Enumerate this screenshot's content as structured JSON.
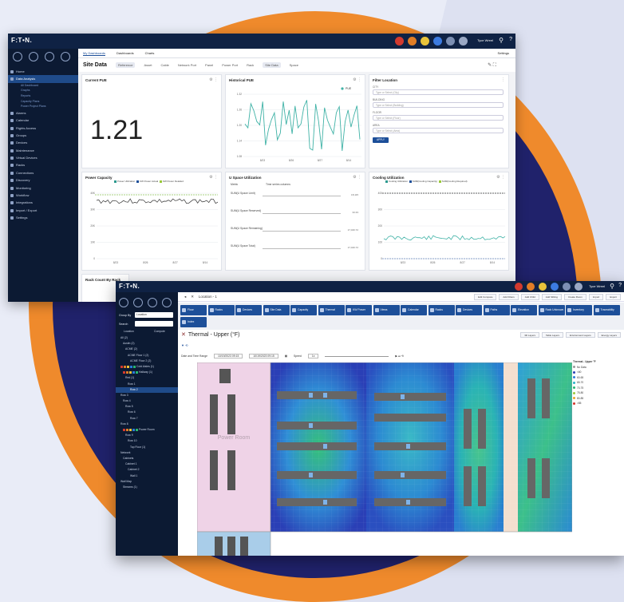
{
  "colors": {
    "ring": "#ef8a2c",
    "ring_inner": "#20226b",
    "topbar": "#0f2244",
    "sidebar": "#0c1a33",
    "accent": "#1d4f99"
  },
  "app1": {
    "logo": "F:T•N.",
    "user_label": "Tyce Wreel",
    "tabs": [
      "My Dashboards",
      "Dashboards",
      "Charts"
    ],
    "settings_label": "Settings",
    "breadcrumb_title": "Site Data",
    "filters": [
      "Reference",
      "Asset",
      "Cable",
      "Network Port",
      "Panel",
      "Power Port",
      "Rack",
      "Site Data",
      "Space"
    ],
    "nav": [
      {
        "label": "Home"
      },
      {
        "label": "Data Analysis",
        "active": true
      },
      {
        "label": "All Dashboard",
        "sub": true
      },
      {
        "label": "Graphs",
        "sub": true
      },
      {
        "label": "Reports",
        "sub": true
      },
      {
        "label": "Capacity Plans",
        "sub": true
      },
      {
        "label": "Power Project Plans",
        "sub": true
      },
      {
        "label": "Alarms"
      },
      {
        "label": "Calendar"
      },
      {
        "label": "Rights Access"
      },
      {
        "label": "Groups"
      },
      {
        "label": "Devices"
      },
      {
        "label": "Maintenance"
      },
      {
        "label": "Virtual Devices"
      },
      {
        "label": "Racks"
      },
      {
        "label": "Connections"
      },
      {
        "label": "Discovery"
      },
      {
        "label": "Monitoring"
      },
      {
        "label": "Workflow"
      },
      {
        "label": "Integrations"
      },
      {
        "label": "Import / Export"
      },
      {
        "label": "Settings"
      }
    ],
    "current_pue": {
      "title": "Current PUE",
      "value": "1.21"
    },
    "historical_pue": {
      "title": "Historical PUE",
      "legend": "PUE",
      "yticks": [
        "1.32",
        "1.26",
        "1.20",
        "1.14",
        "1.08"
      ],
      "xticks": [
        "8/23",
        "8/26",
        "8/27",
        "8/14"
      ]
    },
    "filter_location": {
      "title": "Filter Location",
      "fields": [
        {
          "label": "CITY",
          "placeholder": "Type or Select (City)"
        },
        {
          "label": "BUILDING",
          "placeholder": "Type or Select (Building)"
        },
        {
          "label": "FLOOR",
          "placeholder": "Type or Select (Floor)"
        },
        {
          "label": "AREA",
          "placeholder": "Type or Select (Area)"
        }
      ],
      "apply": "APPLY"
    },
    "power_capacity": {
      "title": "Power Capacity",
      "legend": [
        "Power Utilization",
        "KW Power Actual",
        "KW Power Detailed"
      ],
      "yticks": [
        "40K",
        "30K",
        "20K",
        "10K",
        "0"
      ],
      "xticks": [
        "8/23",
        "8/26",
        "8/27",
        "8/14"
      ]
    },
    "u_space": {
      "title": "U Space Utilization",
      "col1": "Metric",
      "col2": "Time series columns",
      "rows": [
        {
          "label": "SUM(U Space Limit)",
          "values": [
            "18,115",
            "17,230"
          ]
        },
        {
          "label": "SUM(U Space Reserved)",
          "values": [
            "33.33"
          ]
        },
        {
          "label": "SUM(U Space Remaining)",
          "values": [
            "17,040.72",
            "17,022.32"
          ]
        },
        {
          "label": "SUM(U Space Total)",
          "values": [
            "17,040.72",
            "18,094.40"
          ]
        }
      ]
    },
    "cooling": {
      "title": "Cooling Utilization",
      "legend": [
        "Cooling Utilization",
        "SUM(Cooling Capacity)",
        "SUM(Cooling Required)"
      ],
      "yticks": [
        "400",
        "300",
        "200",
        "100",
        "0"
      ],
      "xticks": [
        "8/23",
        "8/26",
        "8/27",
        "8/14"
      ]
    },
    "rack_count": {
      "title": "Rack Count By Rack"
    }
  },
  "app2": {
    "logo": "F:T•N.",
    "user_label": "Tyce Wreel",
    "group_by_label": "Group By",
    "group_by_value": "Location",
    "search_label": "Search",
    "tree_headers": [
      "Location",
      "Compute"
    ],
    "tree": [
      {
        "label": "All (2)"
      },
      {
        "label": "Austin (2)"
      },
      {
        "label": "ACME (2)"
      },
      {
        "label": "ACME Floor 1 (2)"
      },
      {
        "label": "ACME Floor 2 (2)"
      },
      {
        "label": "Cold Aisles (1)"
      },
      {
        "label": "Hallway (1)"
      },
      {
        "label": "Red (1)"
      },
      {
        "label": "Row 1"
      },
      {
        "label": "Row 2",
        "selected": true
      },
      {
        "label": "Row 3"
      },
      {
        "label": "Row 4"
      },
      {
        "label": "Row 5"
      },
      {
        "label": "Row 6"
      },
      {
        "label": "Row 7"
      },
      {
        "label": "Row 8"
      },
      {
        "label": "Power Room"
      },
      {
        "label": "Row 9"
      },
      {
        "label": "Row 10"
      },
      {
        "label": "Top Floor (1)"
      },
      {
        "label": "Network"
      },
      {
        "label": "Cabinets"
      },
      {
        "label": "Cabinet 1"
      },
      {
        "label": "Cabinet 2"
      },
      {
        "label": "Wall 1"
      },
      {
        "label": "Wall Map"
      },
      {
        "label": "Streams (1)"
      }
    ],
    "location_tab": "Location - 1",
    "top_buttons": [
      "Edit Compare",
      "Add Filters",
      "Add Child",
      "Add Sibling",
      "Create Room",
      "Import",
      "Export"
    ],
    "toolbar": [
      "Floor",
      "Racks",
      "Devices",
      "Site Data",
      "Capacity",
      "Thermal",
      "KW Power",
      "Views",
      "Calendar",
      "Racks",
      "Devices",
      "Paths",
      "Elevation",
      "Rack Unknown",
      "Inventory",
      "Traceability",
      "Index"
    ],
    "thermal_title": "Thermal - Upper (°F)",
    "view_chips": [
      "3D Layers",
      "Table Layers",
      "Environment Layers",
      "Energy Layers"
    ],
    "datetime_label": "Date and Time Range",
    "start_date": "10/19/2023 09:15",
    "end_date": "10/19/2023 09:15",
    "speed_label": "Speed",
    "speed_value": "1x",
    "power_room_label": "Power Room",
    "legend_title": "Thermal - Upper °F",
    "legend": [
      {
        "label": "No Data",
        "color": "#999999"
      },
      {
        "label": "<60",
        "color": "#2b3fb4"
      },
      {
        "label": "60-65",
        "color": "#2b7bd6"
      },
      {
        "label": "65-70",
        "color": "#29b3c9"
      },
      {
        "label": "70-75",
        "color": "#27b56f"
      },
      {
        "label": "75-80",
        "color": "#9ac93a"
      },
      {
        "label": "80-85",
        "color": "#e8a32b"
      },
      {
        "label": ">85",
        "color": "#d2342b"
      }
    ]
  }
}
